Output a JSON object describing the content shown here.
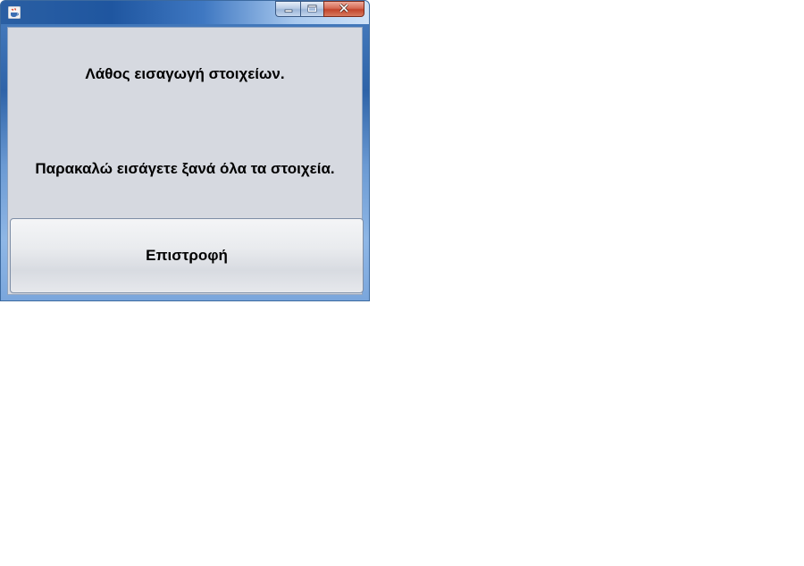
{
  "window": {
    "title": "",
    "icon": "java-coffee-cup-icon",
    "controls": {
      "minimize": "minimize-icon",
      "maximize": "maximize-icon",
      "close": "close-icon"
    }
  },
  "dialog": {
    "message_line1": "Λάθος εισαγωγή στοιχείων.",
    "message_line2": "Παρακαλώ εισάγετε ξανά όλα τα στοιχεία.",
    "back_button_label": "Επιστροφή"
  },
  "colors": {
    "client_background": "#d6d9e0",
    "close_button": "#c2452c",
    "titlebar": "#2a5fa3"
  }
}
